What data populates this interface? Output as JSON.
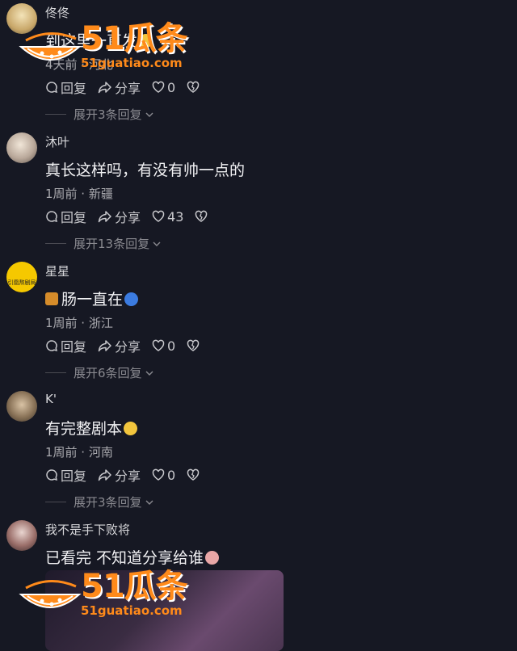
{
  "comments": [
    {
      "username": "佟佟",
      "text": "到这里一直发",
      "meta": "4天前 · 河北",
      "likes": "0",
      "reply_label": "回复",
      "share_label": "分享",
      "expand_label": "展开3条回复"
    },
    {
      "username": "沐叶",
      "text": "真长这样吗，有没有帅一点的",
      "meta": "1周前 · 新疆",
      "likes": "43",
      "reply_label": "回复",
      "share_label": "分享",
      "expand_label": "展开13条回复"
    },
    {
      "username": "星星",
      "text": "肠一直在",
      "meta": "1周前 · 浙江",
      "likes": "0",
      "reply_label": "回复",
      "share_label": "分享",
      "expand_label": "展开6条回复"
    },
    {
      "username": "K'",
      "text": "有完整剧本",
      "meta": "1周前 · 河南",
      "likes": "0",
      "reply_label": "回复",
      "share_label": "分享",
      "expand_label": "展开3条回复"
    },
    {
      "username": "我不是手下败将",
      "text": "已看完 不知道分享给谁"
    }
  ],
  "avatar3_text": "引凰熬剧局",
  "watermark": {
    "brand": "51瓜条",
    "url": "51guatiao.com"
  },
  "colors": {
    "background": "#161823",
    "watermark": "#ff8a1a"
  }
}
